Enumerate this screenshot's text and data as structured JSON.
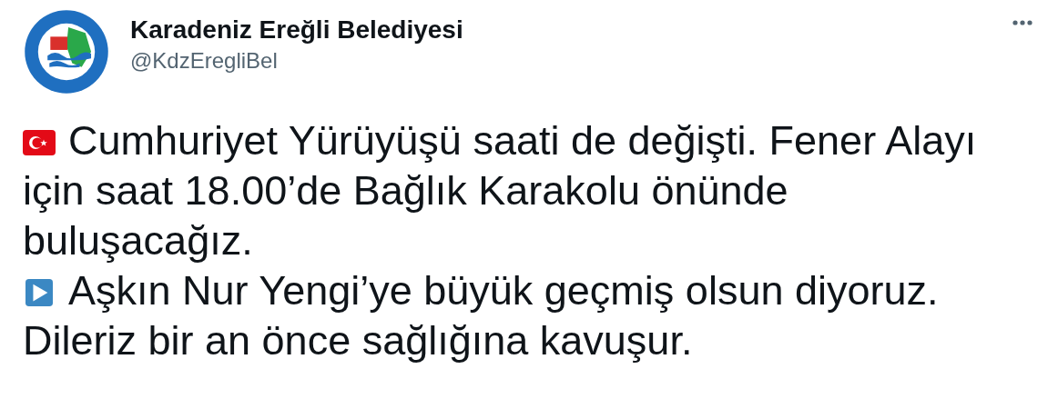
{
  "author": {
    "name": "Karadeniz Ereğli Belediyesi",
    "handle": "@KdzEregliBel"
  },
  "paragraphs": [
    {
      "kind": "flag",
      "lines": [
        "Cumhuriyet Yürüyüşü saati de değişti. Fener Alayı",
        "için saat 18.00’de Bağlık Karakolu önünde",
        "buluşacağız."
      ]
    },
    {
      "kind": "play",
      "lines": [
        "Aşkın Nur Yengi’ye büyük geçmiş olsun diyoruz.",
        "Dileriz bir an önce sağlığına kavuşur."
      ]
    }
  ]
}
